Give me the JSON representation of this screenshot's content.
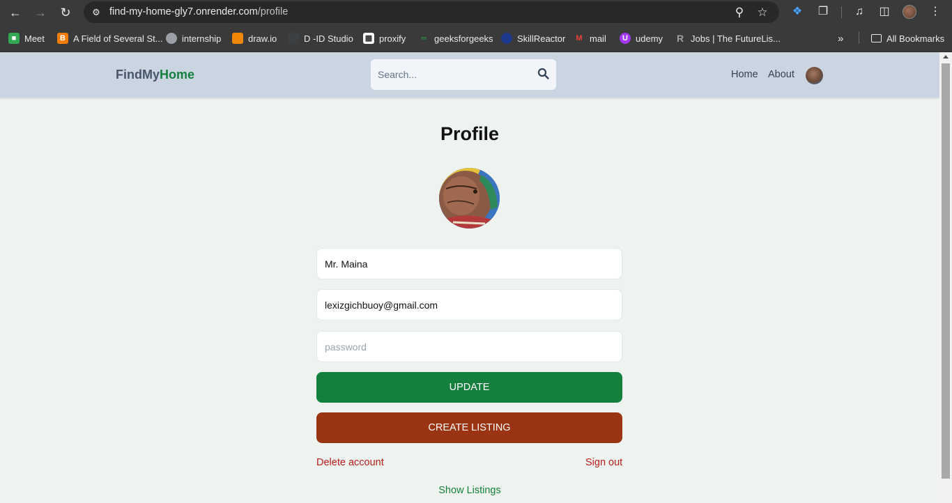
{
  "browser": {
    "url_host": "find-my-home-gly7.onrender.com",
    "url_path": "/profile",
    "bookmarks": [
      {
        "label": "Meet",
        "icon": "google-meet-icon",
        "color": "#34a853"
      },
      {
        "label": "A Field of Several St...",
        "icon": "blogger-icon",
        "color": "#f57c00"
      },
      {
        "label": "internship",
        "icon": "globe-icon",
        "color": "#9aa0a6"
      },
      {
        "label": "draw.io",
        "icon": "drawio-icon",
        "color": "#f08705"
      },
      {
        "label": "D -ID Studio",
        "icon": "did-icon",
        "color": "#5f6368"
      },
      {
        "label": "proxify",
        "icon": "proxify-icon",
        "color": "#ffffff"
      },
      {
        "label": "geeksforgeeks",
        "icon": "gfg-icon",
        "color": "#2f8d46"
      },
      {
        "label": "SkillReactor",
        "icon": "skillreactor-icon",
        "color": "#1e3a8a"
      },
      {
        "label": "mail",
        "icon": "gmail-icon",
        "color": "#ea4335"
      },
      {
        "label": "udemy",
        "icon": "udemy-icon",
        "color": "#a435f0"
      },
      {
        "label": "Jobs | The FutureLis...",
        "icon": "futurelist-icon",
        "color": "#5f6368"
      }
    ],
    "all_bookmarks_label": "All Bookmarks"
  },
  "header": {
    "logo_part1": "FindMy",
    "logo_part2": "Home",
    "search_placeholder": "Search...",
    "nav_home": "Home",
    "nav_about": "About"
  },
  "profile": {
    "title": "Profile",
    "username_value": "Mr. Maina",
    "email_value": "lexizgichbuoy@gmail.com",
    "password_placeholder": "password",
    "update_label": "UPDATE",
    "create_listing_label": "CREATE LISTING",
    "delete_account_label": "Delete account",
    "sign_out_label": "Sign out",
    "show_listings_label": "Show Listings"
  },
  "colors": {
    "brand_green": "#15803d",
    "brand_slate": "#475569",
    "create_listing": "#9a3412",
    "danger": "#b91c1c",
    "header_bg": "#cbd5e1",
    "page_bg": "#eef3ef"
  }
}
